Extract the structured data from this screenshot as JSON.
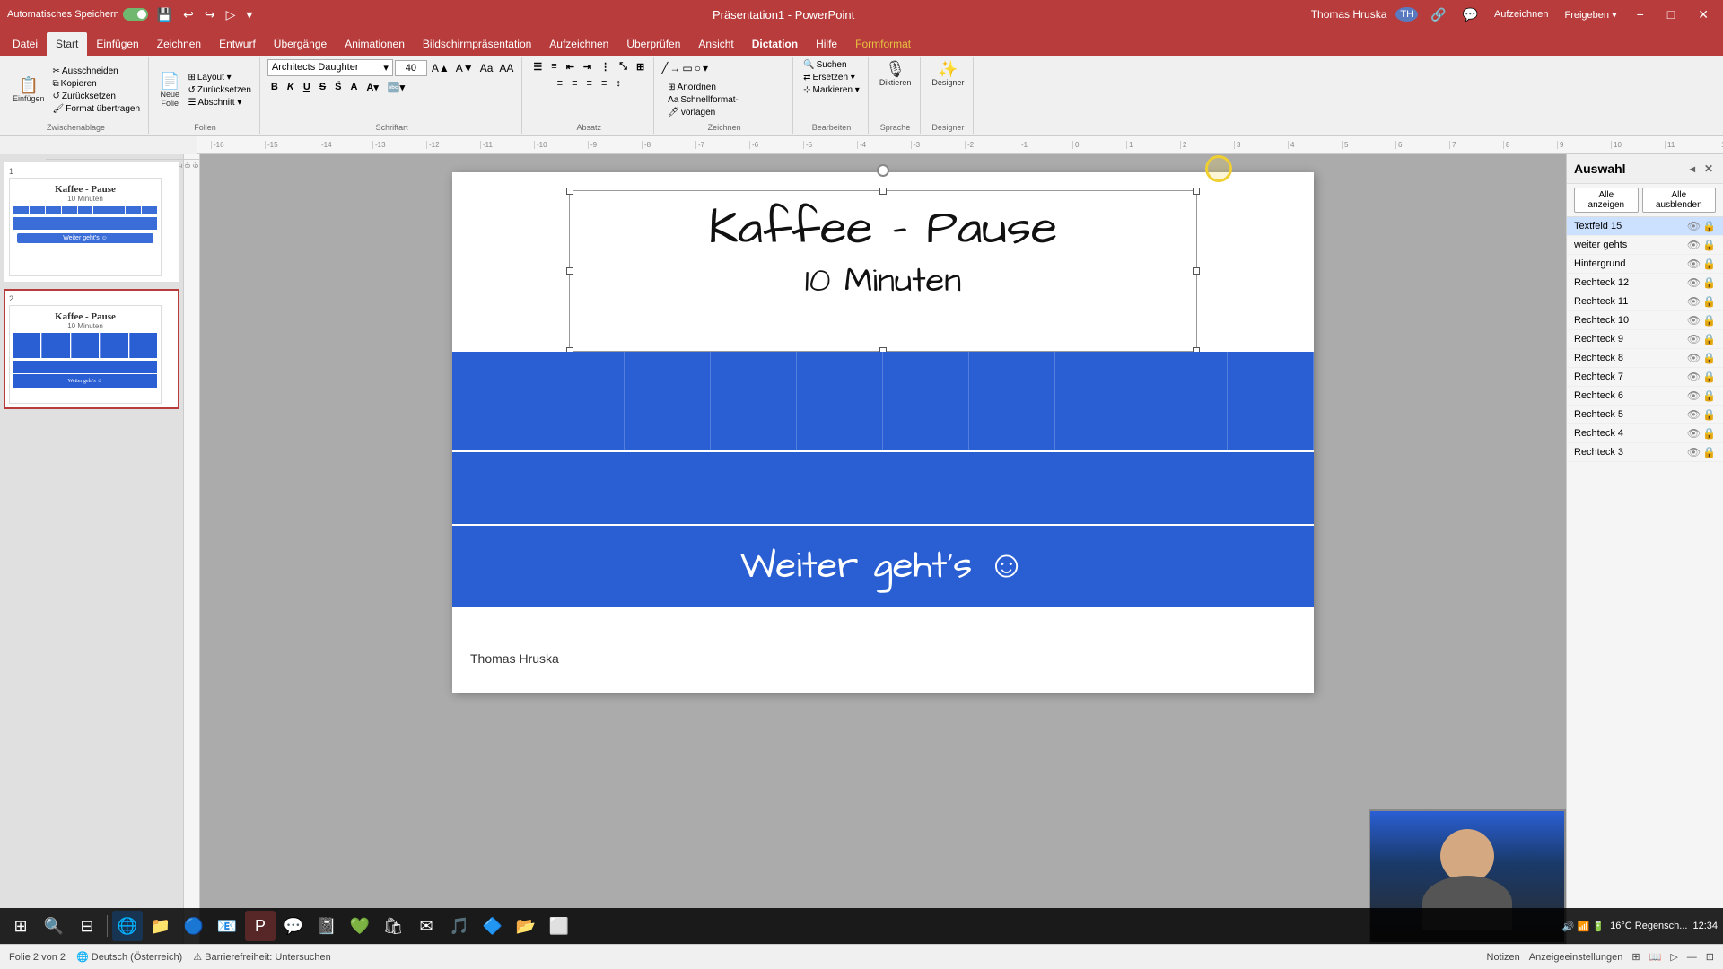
{
  "titleBar": {
    "autosave": "Automatisches Speichern",
    "title": "Präsentation1 - PowerPoint",
    "searchPlaceholder": "Suchen",
    "userName": "Thomas Hruska",
    "initials": "TH",
    "minBtn": "−",
    "maxBtn": "□",
    "closeBtn": "✕"
  },
  "ribbonTabs": {
    "tabs": [
      {
        "label": "Datei",
        "active": false
      },
      {
        "label": "Start",
        "active": true
      },
      {
        "label": "Einfügen",
        "active": false
      },
      {
        "label": "Zeichnen",
        "active": false
      },
      {
        "label": "Entwurf",
        "active": false
      },
      {
        "label": "Übergänge",
        "active": false
      },
      {
        "label": "Animationen",
        "active": false
      },
      {
        "label": "Bildschirmpräsentation",
        "active": false
      },
      {
        "label": "Aufzeichnen",
        "active": false
      },
      {
        "label": "Überprüfen",
        "active": false
      },
      {
        "label": "Ansicht",
        "active": false
      },
      {
        "label": "Dictation",
        "active": false
      },
      {
        "label": "Hilfe",
        "active": false
      },
      {
        "label": "Formformat",
        "active": false
      }
    ]
  },
  "ribbon": {
    "fontName": "Architects Daughter",
    "fontSize": "40",
    "groups": [
      {
        "label": "Zwischenablage"
      },
      {
        "label": "Folien"
      },
      {
        "label": "Schriftart"
      },
      {
        "label": "Absatz"
      },
      {
        "label": "Zeichnen"
      },
      {
        "label": "Bearbeiten"
      },
      {
        "label": "Sprache"
      },
      {
        "label": "Designer"
      }
    ],
    "buttons": {
      "ausschneiden": "Ausschneiden",
      "kopieren": "Kopieren",
      "zurücksetzen": "Zurücksetzen",
      "formatübertragen": "Format übertragen",
      "neueF": "Neue Folie",
      "layout": "Layout",
      "abschnitt": "Abschnitt",
      "diktieren": "Diktieren",
      "designer": "Designer"
    }
  },
  "slides": [
    {
      "num": "1",
      "title": "Kaffee - Pause",
      "sub": "10 Minuten",
      "active": false
    },
    {
      "num": "2",
      "title": "Kaffee - Pause",
      "sub": "10 Minuten",
      "active": true
    }
  ],
  "slideContent": {
    "title": "Kaffee - Pause",
    "subtitle": "10 Minuten",
    "weiter": "Weiter geht's ☺",
    "author": "Thomas Hruska",
    "blueRectCols": 10
  },
  "rightPanel": {
    "title": "Auswahl",
    "showAll": "Alle anzeigen",
    "hideAll": "Alle ausblenden",
    "layers": [
      {
        "name": "Textfeld 15",
        "selected": true
      },
      {
        "name": "weiter gehts",
        "selected": false
      },
      {
        "name": "Hintergrund",
        "selected": false
      },
      {
        "name": "Rechteck 12",
        "selected": false
      },
      {
        "name": "Rechteck 11",
        "selected": false
      },
      {
        "name": "Rechteck 10",
        "selected": false
      },
      {
        "name": "Rechteck 9",
        "selected": false
      },
      {
        "name": "Rechteck 8",
        "selected": false
      },
      {
        "name": "Rechteck 7",
        "selected": false
      },
      {
        "name": "Rechteck 6",
        "selected": false
      },
      {
        "name": "Rechteck 5",
        "selected": false
      },
      {
        "name": "Rechteck 4",
        "selected": false
      },
      {
        "name": "Rechteck 3",
        "selected": false
      }
    ]
  },
  "statusBar": {
    "slideInfo": "Folie 2 von 2",
    "language": "Deutsch (Österreich)",
    "accessibility": "Barrierefreiheit: Untersuchen",
    "notes": "Notizen",
    "viewSettings": "Anzeigeeinstellungen"
  },
  "taskbar": {
    "weather": "16°C  Regensch...",
    "time": "12:34"
  },
  "colors": {
    "accent": "#b83c3c",
    "blue": "#2a5fd4",
    "white": "#ffffff",
    "selectedLayer": "#cce0ff"
  }
}
